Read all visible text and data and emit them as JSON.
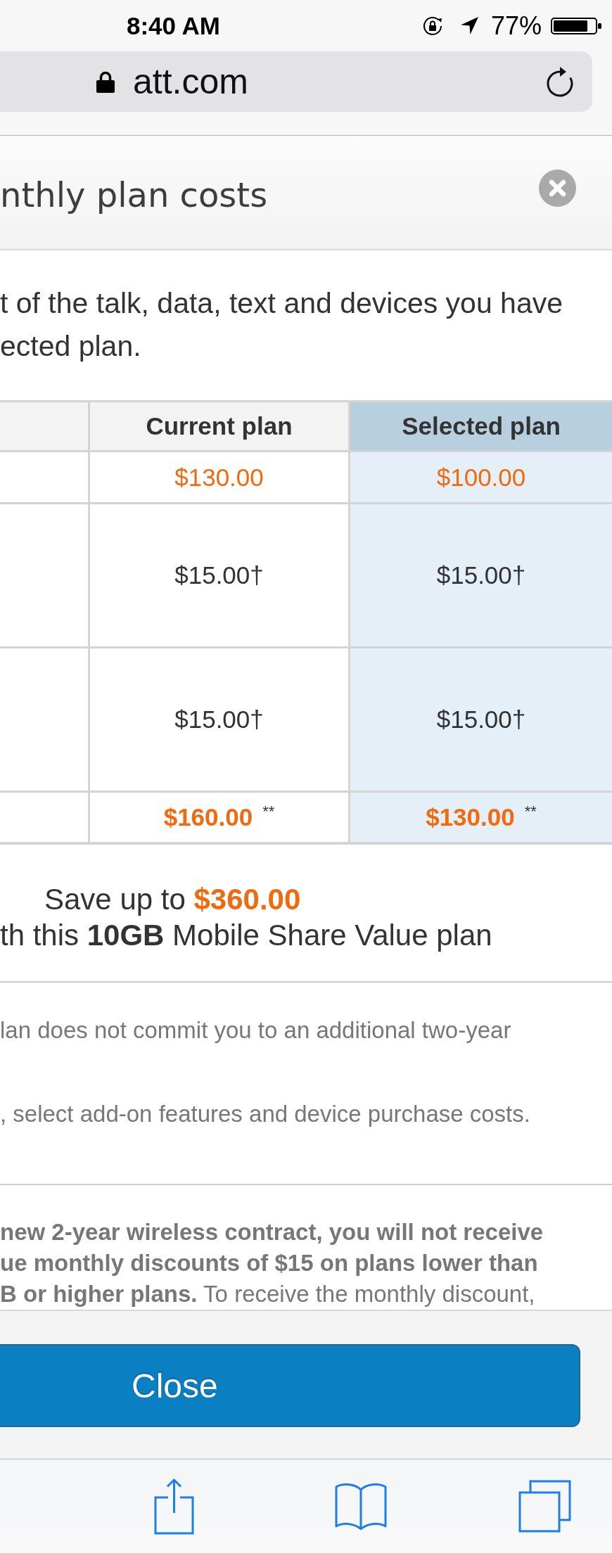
{
  "status_bar": {
    "time": "8:40 AM",
    "battery_text": "77%"
  },
  "address_bar": {
    "url": "att.com"
  },
  "dialog": {
    "title": "nthly plan costs",
    "intro_lines": [
      "t of the talk, data, text and devices you have",
      "ected plan."
    ],
    "table": {
      "columns": [
        {
          "label": "Current plan",
          "highlighted": false
        },
        {
          "label": "Selected plan",
          "highlighted": true
        }
      ],
      "rows": [
        {
          "kind": "price",
          "cells": [
            {
              "value": "$130.00"
            },
            {
              "value": "$100.00"
            }
          ]
        },
        {
          "kind": "fee",
          "cells": [
            {
              "value": "$15.00†"
            },
            {
              "value": "$15.00†"
            }
          ]
        },
        {
          "kind": "fee",
          "cells": [
            {
              "value": "$15.00†"
            },
            {
              "value": "$15.00†"
            }
          ]
        },
        {
          "kind": "total",
          "cells": [
            {
              "value": "$160.00",
              "footnote_mark": "**"
            },
            {
              "value": "$130.00",
              "footnote_mark": "**"
            }
          ]
        }
      ]
    },
    "savings_lines": [
      "Save up to **$360.00**",
      "th this **10GB** Mobile Share Value plan"
    ],
    "notes": [
      "lan does not commit you to an additional two-year",
      ", select add-on features and device purchase costs."
    ],
    "disclaimer_lines": [
      "**new 2-year wireless contract, you will not receive**",
      "**ue monthly discounts of $15 on plans lower than**",
      "**B or higher plans.** To receive the monthly discount,"
    ],
    "close_button": "Close"
  }
}
